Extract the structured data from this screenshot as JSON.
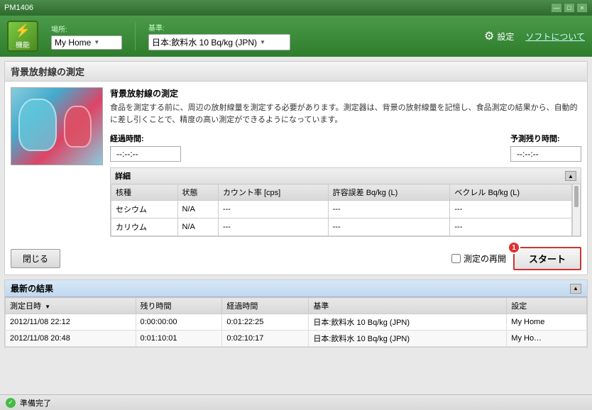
{
  "titleBar": {
    "title": "PM1406",
    "minimizeLabel": "—",
    "maximizeLabel": "□",
    "closeLabel": "×"
  },
  "toolbar": {
    "iconSymbol": "⚡",
    "iconLabel": "機能",
    "locationLabel": "場所:",
    "locationValue": "My Home",
    "standardLabel": "基準:",
    "standardValue": "日本:飲料水 10 Bq/kg (JPN)",
    "settingsLabel": "設定",
    "aboutLabel": "ソフトについて"
  },
  "measurementSection": {
    "title": "背景放射線の測定",
    "descTitle": "背景放射線の測定",
    "desc": "食品を測定する前に、周辺の放射線量を測定する必要があります。測定器は、背景の放射線量を記憶し、食品測定の結果から、自動的に差し引くことで、精度の高い測定ができるようになっています。",
    "elapsedLabel": "経過時間:",
    "elapsedValue": "--:--:--",
    "remainingLabel": "予測残り時間:",
    "remainingValue": "--:--:--",
    "detailsLabel": "詳細",
    "tableHeaders": [
      "核種",
      "状態",
      "カウント率 [cps]",
      "許容誤差 Bq/kg (L)",
      "ベクレル Bq/kg (L)"
    ],
    "tableRows": [
      {
        "nuclide": "セシウム",
        "status": "N/A",
        "countRate": "---",
        "tolerance": "---",
        "becquerel": "---"
      },
      {
        "nuclide": "カリウム",
        "status": "N/A",
        "countRate": "---",
        "tolerance": "---",
        "becquerel": "---"
      }
    ],
    "closeLabel": "閉じる",
    "remeasureLabel": "測定の再開",
    "startLabel": "スタート",
    "badge": "1"
  },
  "resultsSection": {
    "title": "最新の結果",
    "tableHeaders": [
      "測定日時",
      "残り時間",
      "経過時間",
      "基準",
      "設定"
    ],
    "tableRows": [
      {
        "date": "2012/11/08 22:12",
        "remaining": "0:00:00:00",
        "elapsed": "0:01:22:25",
        "standard": "日本:飲料水 10 Bq/kg (JPN)",
        "settings": "My Home"
      },
      {
        "date": "2012/11/08 20:48",
        "remaining": "0:01:10:01",
        "elapsed": "0:02:10:17",
        "standard": "日本:飲料水 10 Bq/kg (JPN)",
        "settings": "My Home"
      }
    ]
  },
  "statusBar": {
    "statusText": "準備完了"
  }
}
